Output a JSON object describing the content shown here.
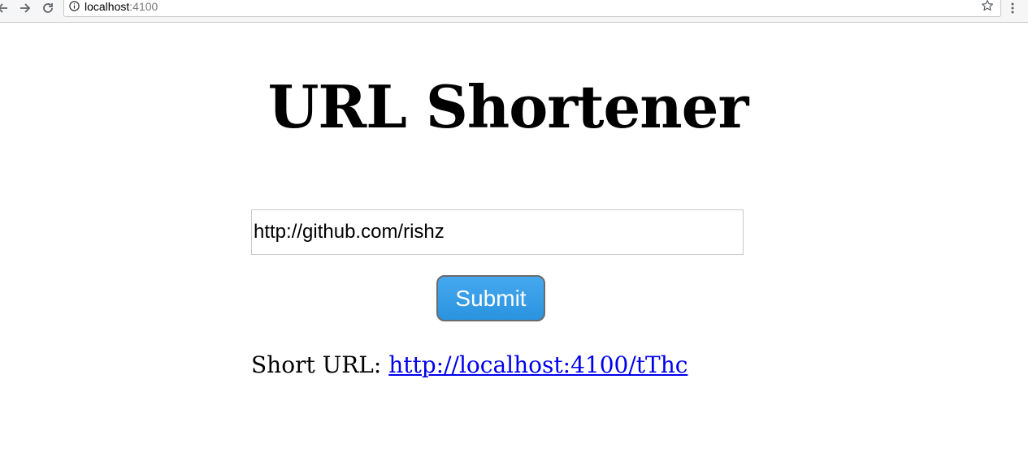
{
  "browser": {
    "url_host": "localhost",
    "url_port": ":4100",
    "icons": {
      "back": "back-arrow-icon",
      "forward": "forward-arrow-icon",
      "reload": "reload-icon",
      "info": "info-icon",
      "bookmark": "star-icon",
      "menu": "kebab-menu-icon"
    }
  },
  "page": {
    "title": "URL Shortener",
    "input_value": "http://github.com/rishz",
    "submit_label": "Submit",
    "result_label": "Short URL: ",
    "short_url": "http://localhost:4100/tThc"
  },
  "colors": {
    "button": "#3a9fe8",
    "link": "#0000ee"
  }
}
